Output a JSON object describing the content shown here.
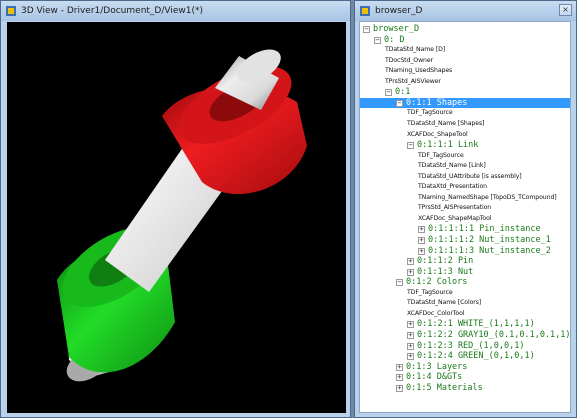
{
  "view3d": {
    "title": "3D View - Driver1/Document_D/View1(*)"
  },
  "browser": {
    "title": "browser_D"
  },
  "colors": {
    "red_part": "#e8171b",
    "green_part": "#19d11e",
    "pin": "#d7d7d7",
    "selection": "#3399ff",
    "tree_text": "#1a7a1a"
  },
  "tree": [
    {
      "label": "browser_D",
      "depth": 0,
      "kind": "mono",
      "expander": "minus",
      "id": "root"
    },
    {
      "label": "0: D",
      "depth": 1,
      "kind": "mono",
      "expander": "minus",
      "id": "d"
    },
    {
      "label": "TDataStd_Name [D]",
      "depth": 2,
      "kind": "attr"
    },
    {
      "label": "TDocStd_Owner",
      "depth": 2,
      "kind": "attr"
    },
    {
      "label": "TNaming_UsedShapes",
      "depth": 2,
      "kind": "attr"
    },
    {
      "label": "TPrsStd_AISViewer",
      "depth": 2,
      "kind": "attr"
    },
    {
      "label": "0:1",
      "depth": 2,
      "kind": "mono",
      "expander": "minus",
      "id": "l01"
    },
    {
      "label": "0:1:1 Shapes",
      "depth": 3,
      "kind": "mono",
      "expander": "minus",
      "selected": true,
      "id": "shapes"
    },
    {
      "label": "TDF_TagSource",
      "depth": 4,
      "kind": "attr"
    },
    {
      "label": "TDataStd_Name [Shapes]",
      "depth": 4,
      "kind": "attr"
    },
    {
      "label": "XCAFDoc_ShapeTool",
      "depth": 4,
      "kind": "attr"
    },
    {
      "label": "0:1:1:1 Link",
      "depth": 4,
      "kind": "mono",
      "expander": "minus",
      "id": "link"
    },
    {
      "label": "TDF_TagSource",
      "depth": 5,
      "kind": "attr"
    },
    {
      "label": "TDataStd_Name [Link]",
      "depth": 5,
      "kind": "attr"
    },
    {
      "label": "TDataStd_UAttribute [is assembly]",
      "depth": 5,
      "kind": "attr"
    },
    {
      "label": "TDataXtd_Presentation",
      "depth": 5,
      "kind": "attr"
    },
    {
      "label": "TNaming_NamedShape [TopoDS_TCompound]",
      "depth": 5,
      "kind": "attr"
    },
    {
      "label": "TPrsStd_AISPresentation",
      "depth": 5,
      "kind": "attr"
    },
    {
      "label": "XCAFDoc_ShapeMapTool",
      "depth": 5,
      "kind": "attr"
    },
    {
      "label": "0:1:1:1:1 Pin_instance",
      "depth": 5,
      "kind": "mono",
      "expander": "plus"
    },
    {
      "label": "0:1:1:1:2 Nut_instance_1",
      "depth": 5,
      "kind": "mono",
      "expander": "plus"
    },
    {
      "label": "0:1:1:1:3 Nut_instance_2",
      "depth": 5,
      "kind": "mono",
      "expander": "plus"
    },
    {
      "label": "0:1:1:2 Pin",
      "depth": 4,
      "kind": "mono",
      "expander": "plus"
    },
    {
      "label": "0:1:1:3 Nut",
      "depth": 4,
      "kind": "mono",
      "expander": "plus"
    },
    {
      "label": "0:1:2 Colors",
      "depth": 3,
      "kind": "mono",
      "expander": "minus",
      "id": "colors"
    },
    {
      "label": "TDF_TagSource",
      "depth": 4,
      "kind": "attr"
    },
    {
      "label": "TDataStd_Name [Colors]",
      "depth": 4,
      "kind": "attr"
    },
    {
      "label": "XCAFDoc_ColorTool",
      "depth": 4,
      "kind": "attr"
    },
    {
      "label": "0:1:2:1 WHITE_(1,1,1,1)",
      "depth": 4,
      "kind": "mono",
      "expander": "plus"
    },
    {
      "label": "0:1:2:2 GRAY10_(0.1,0.1,0.1,1)",
      "depth": 4,
      "kind": "mono",
      "expander": "plus"
    },
    {
      "label": "0:1:2:3 RED_(1,0,0,1)",
      "depth": 4,
      "kind": "mono",
      "expander": "plus"
    },
    {
      "label": "0:1:2:4 GREEN_(0,1,0,1)",
      "depth": 4,
      "kind": "mono",
      "expander": "plus"
    },
    {
      "label": "0:1:3 Layers",
      "depth": 3,
      "kind": "mono",
      "expander": "plus"
    },
    {
      "label": "0:1:4 D&GTs",
      "depth": 3,
      "kind": "mono",
      "expander": "plus"
    },
    {
      "label": "0:1:5 Materials",
      "depth": 3,
      "kind": "mono",
      "expander": "plus"
    }
  ]
}
